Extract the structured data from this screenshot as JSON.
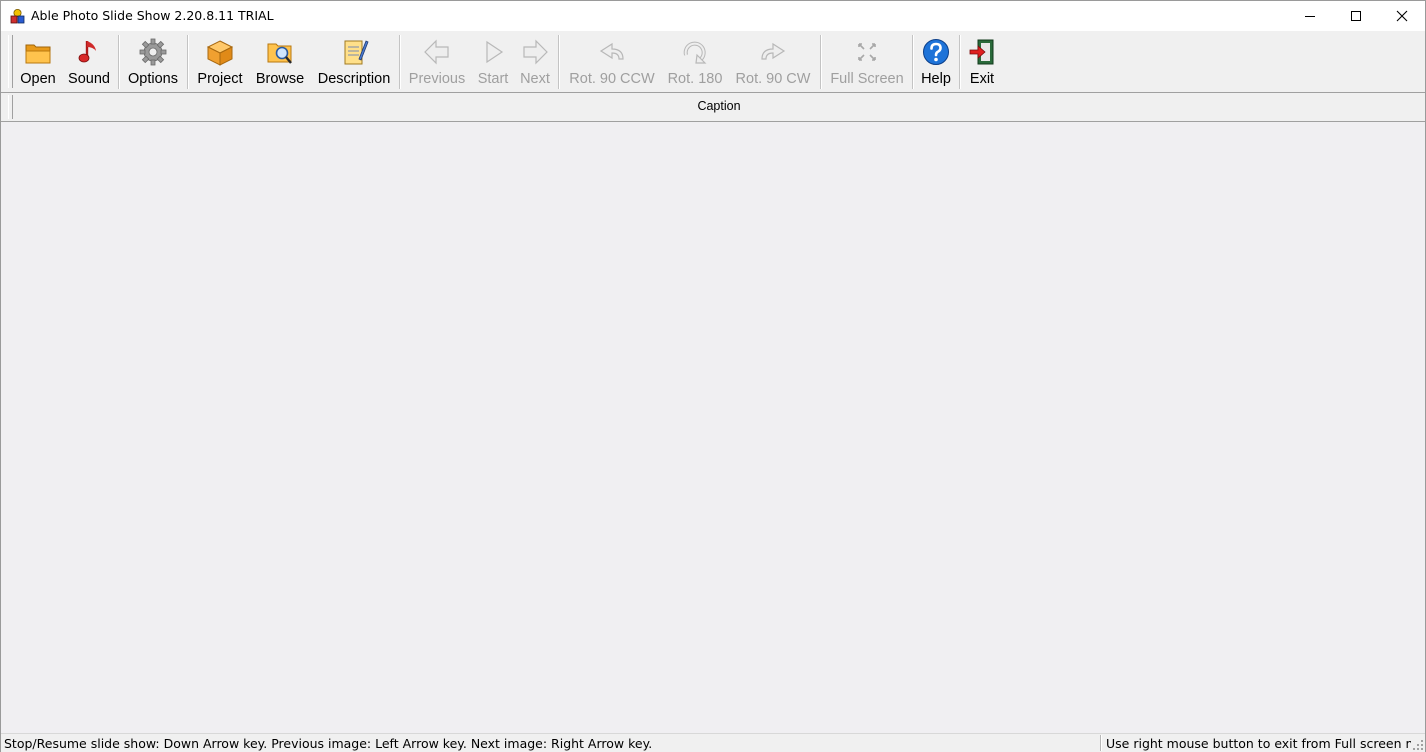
{
  "window": {
    "title": "Able Photo Slide Show 2.20.8.11 TRIAL"
  },
  "toolbar": {
    "open": "Open",
    "sound": "Sound",
    "options": "Options",
    "project": "Project",
    "browse": "Browse",
    "description": "Description",
    "previous": "Previous",
    "start": "Start",
    "next": "Next",
    "rot_ccw": "Rot. 90 CCW",
    "rot_180": "Rot. 180",
    "rot_cw": "Rot. 90 CW",
    "full_screen": "Full Screen",
    "help": "Help",
    "exit": "Exit"
  },
  "caption": {
    "label": "Caption"
  },
  "status": {
    "left": "Stop/Resume slide show: Down Arrow key. Previous image: Left Arrow key. Next image: Right Arrow key.",
    "right": "Use right mouse button to exit from Full screen mode"
  },
  "colors": {
    "disabled_text": "#9f9f9f",
    "viewer_bg": "#f0eff2",
    "folder_orange": "#f5a623",
    "help_blue": "#1e73d8",
    "exit_red": "#e02020"
  }
}
